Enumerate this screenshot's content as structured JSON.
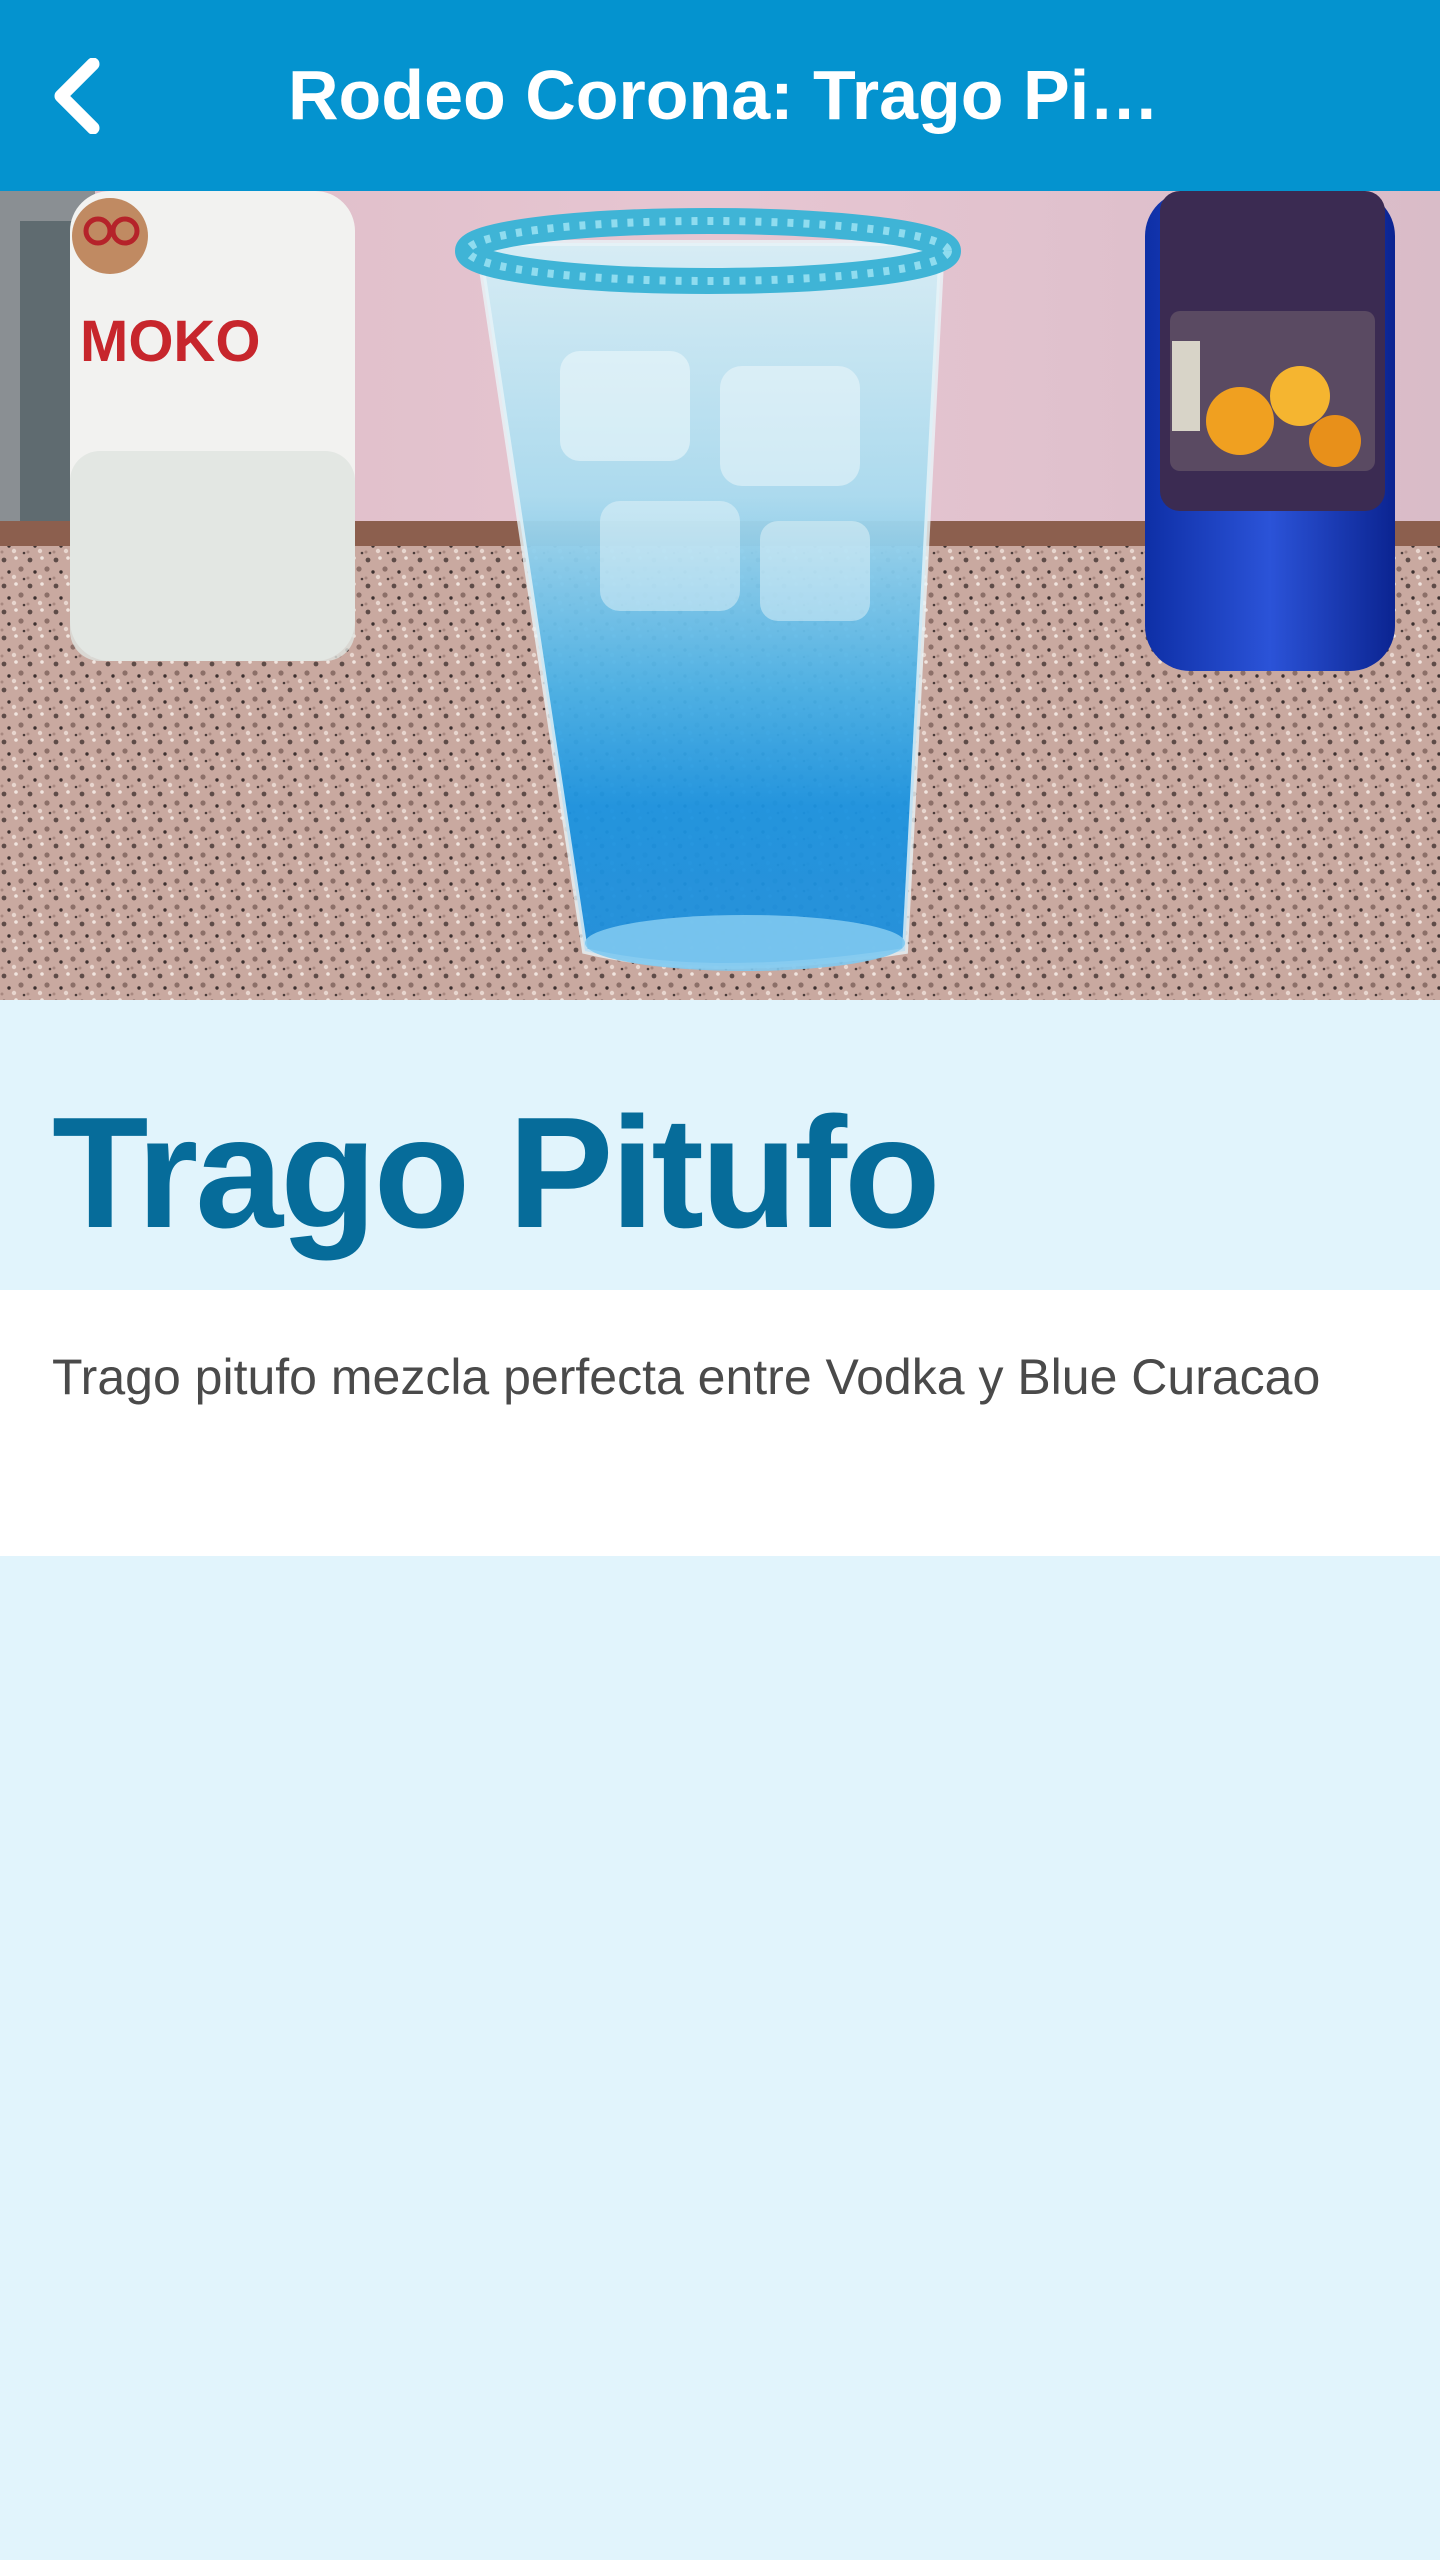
{
  "app_bar": {
    "title": "Rodeo Corona: Trago Pit…",
    "back_icon": "chevron-left-icon",
    "background_color": "#0493cf"
  },
  "hero": {
    "image_subject": "blue cocktail glass with sugared rim on granite counter"
  },
  "recipe": {
    "title": "Trago Pitufo",
    "description": "Trago pitufo mezcla perfecta entre Vodka y Blue Curacao"
  },
  "colors": {
    "title_color": "#066c9a",
    "page_background": "#e1f4fc",
    "card_background": "#ffffff",
    "text_color": "#4a4a4a"
  }
}
